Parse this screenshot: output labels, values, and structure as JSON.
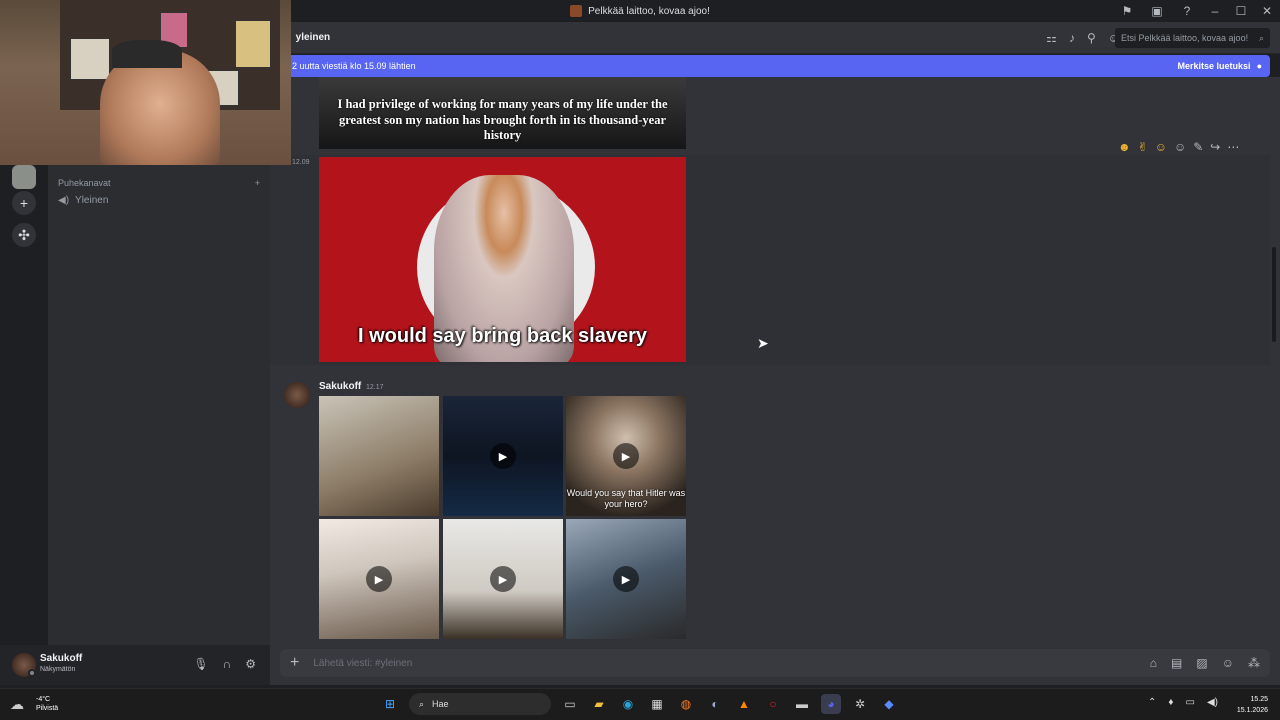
{
  "window": {
    "title": "Pelkkää laittoo, kovaa ajoo!",
    "controls": [
      "⚑",
      "▣",
      "?",
      "–",
      "☐",
      "✕"
    ]
  },
  "header": {
    "channel": "yleinen",
    "search_placeholder": "Etsi Pelkkää laittoo, kovaa ajoo!",
    "icons": [
      "threads-icon",
      "bell-icon",
      "pin-icon",
      "members-icon"
    ]
  },
  "new_messages_bar": {
    "text": "2 uutta viestiä klo 15.09 lähtien",
    "action": "Merkitse luetuksi"
  },
  "sidebar": {
    "category": "Puhekanavat",
    "channels": [
      {
        "label": "Yleinen",
        "type": "voice"
      }
    ]
  },
  "messages": [
    {
      "image_caption": "I had privilege of working for many years of my life under the greatest son my nation has brought forth in its thousand-year history"
    },
    {
      "time": "12.09",
      "image_caption": "I would say bring back slavery"
    },
    {
      "author": "Sakukoff",
      "time": "12.17",
      "tiles": [
        {
          "caption": "",
          "video": false
        },
        {
          "caption": "",
          "video": true
        },
        {
          "caption": "Would you say that Hitler was your hero?",
          "video": true
        },
        {
          "caption": "",
          "video": true
        },
        {
          "caption": "",
          "video": true
        },
        {
          "caption": "",
          "video": true
        }
      ]
    }
  ],
  "composer": {
    "placeholder": "Lähetä viesti: #yleinen"
  },
  "user_panel": {
    "name": "Sakukoff",
    "status": "Näkymätön"
  },
  "taskbar": {
    "weather_temp": "-4°C",
    "weather_desc": "Pilvistä",
    "search_label": "Hae",
    "time": "15.25",
    "date": "15.1.2026"
  },
  "colors": {
    "accent": "#5865f2",
    "background": "#313338",
    "sidebar": "#2b2d31"
  }
}
